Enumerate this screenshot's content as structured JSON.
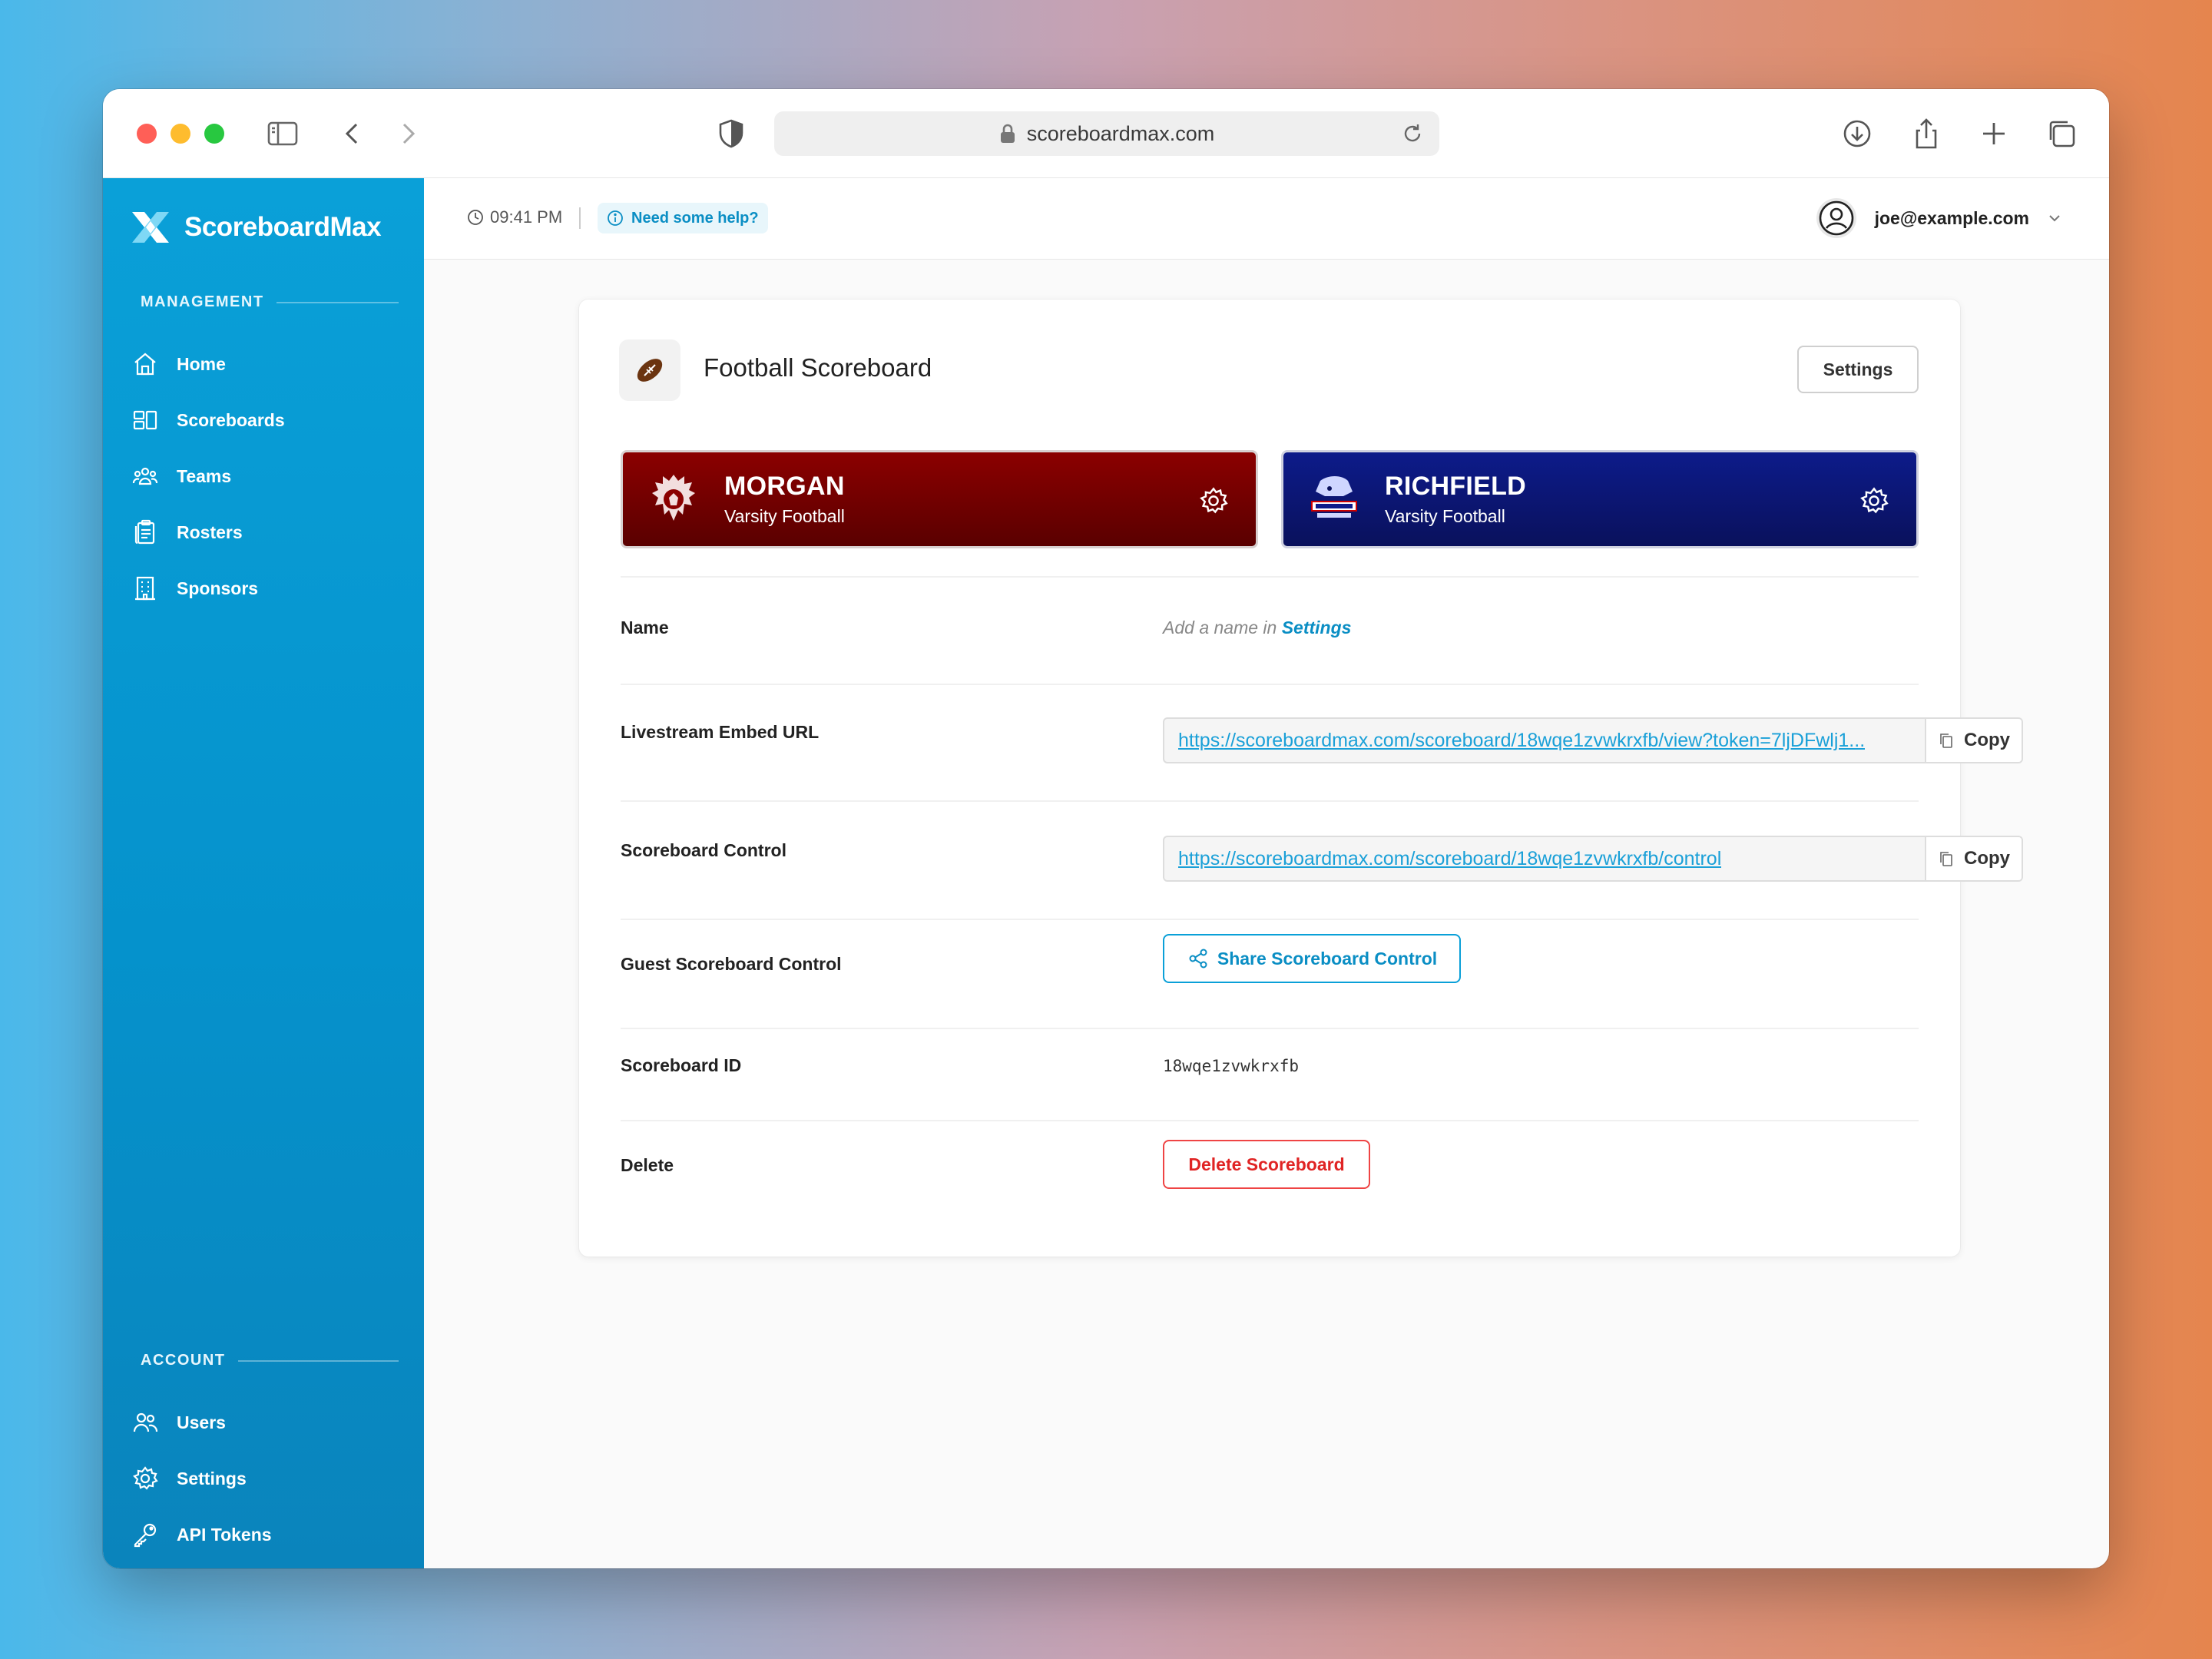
{
  "browser": {
    "url": "scoreboardmax.com",
    "traffic_lights": [
      "#ff5f57",
      "#febc2e",
      "#28c840"
    ]
  },
  "brand": {
    "name": "ScoreboardMax"
  },
  "sidebar": {
    "management_label": "MANAGEMENT",
    "management_items": [
      {
        "label": "Home",
        "icon": "home-icon"
      },
      {
        "label": "Scoreboards",
        "icon": "scoreboards-icon"
      },
      {
        "label": "Teams",
        "icon": "teams-icon"
      },
      {
        "label": "Rosters",
        "icon": "rosters-icon"
      },
      {
        "label": "Sponsors",
        "icon": "sponsors-icon"
      }
    ],
    "account_label": "ACCOUNT",
    "account_items": [
      {
        "label": "Users",
        "icon": "users-icon"
      },
      {
        "label": "Settings",
        "icon": "gear-icon"
      },
      {
        "label": "API Tokens",
        "icon": "key-icon"
      }
    ]
  },
  "header": {
    "time": "09:41 PM",
    "help": "Need some help?",
    "user_email": "joe@example.com"
  },
  "card": {
    "title": "Football Scoreboard",
    "settings_button": "Settings",
    "teams": [
      {
        "name": "MORGAN",
        "subtitle": "Varsity Football",
        "color": "#7a0000"
      },
      {
        "name": "RICHFIELD",
        "subtitle": "Varsity Football",
        "color": "#0c1670"
      }
    ],
    "fields": {
      "name_label": "Name",
      "name_hint": "Add a name in ",
      "name_hint_link": "Settings",
      "embed_label": "Livestream Embed URL",
      "embed_url": "https://scoreboardmax.com/scoreboard/18wqe1zvwkrxfb/view?token=7ljDFwlj1...",
      "control_label": "Scoreboard Control",
      "control_url": "https://scoreboardmax.com/scoreboard/18wqe1zvwkrxfb/control",
      "copy_label": "Copy",
      "guest_label": "Guest Scoreboard Control",
      "share_button": "Share Scoreboard Control",
      "id_label": "Scoreboard ID",
      "id_value": "18wqe1zvwkrxfb",
      "delete_label": "Delete",
      "delete_button": "Delete Scoreboard"
    }
  }
}
